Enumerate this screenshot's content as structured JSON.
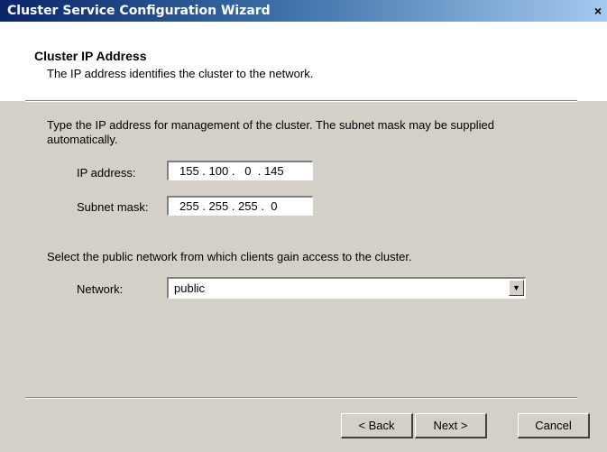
{
  "window": {
    "title": "Cluster Service Configuration Wizard",
    "close_glyph": "×"
  },
  "header": {
    "title": "Cluster IP Address",
    "subtitle": "The IP address identifies the cluster to the network."
  },
  "body": {
    "instruction_line1": "Type the IP address for management of the cluster. The subnet mask may be supplied",
    "instruction_line2": "automatically.",
    "ip_label": "IP address:",
    "ip_value": "155 . 100 .   0  . 145",
    "subnet_label": "Subnet mask:",
    "subnet_value": "255 . 255 . 255 .  0",
    "network_instruction": "Select the public network from which clients gain access to the cluster.",
    "network_label": "Network:",
    "network_value": "public"
  },
  "buttons": {
    "back": "< Back",
    "next": "Next >",
    "cancel": "Cancel"
  },
  "colors": {
    "titlebar_start": "#0a246a",
    "titlebar_end": "#a6caf0",
    "dialog_bg": "#d4d0c8",
    "header_bg": "#ffffff"
  }
}
